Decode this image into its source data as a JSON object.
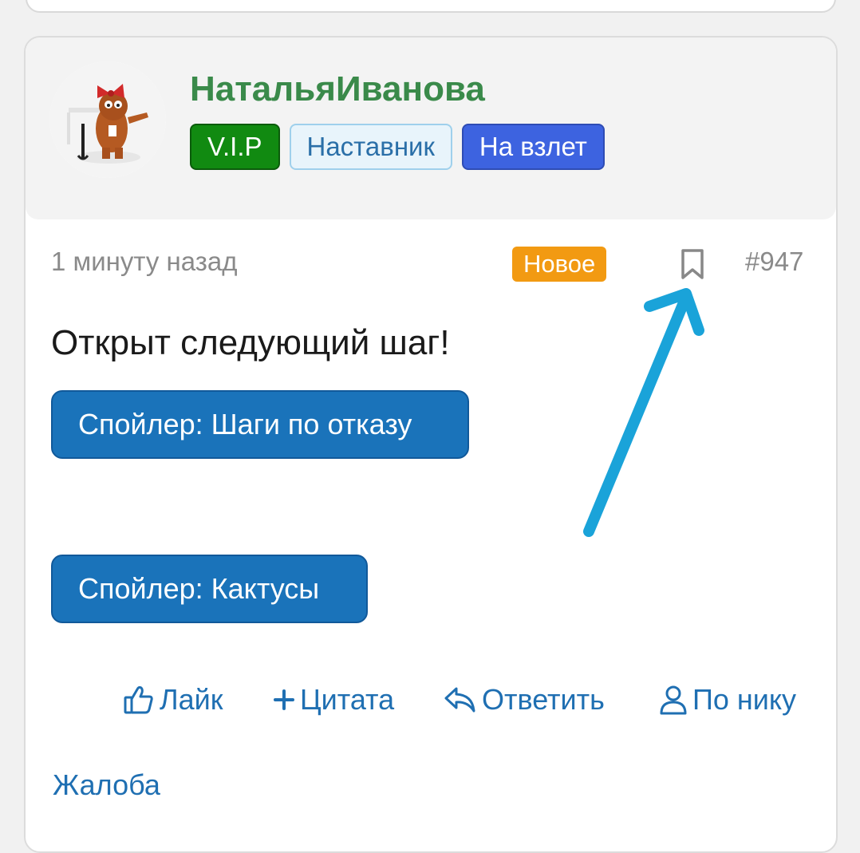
{
  "author": {
    "name": "НатальяИванова",
    "badges": [
      "V.I.P",
      "Наставник",
      "На взлет"
    ]
  },
  "post": {
    "time": "1 минуту назад",
    "new_label": "Новое",
    "number": "#947",
    "text": "Открыт следующий шаг!",
    "spoilers": [
      "Спойлер: Шаги по отказу",
      "Спойлер: Кактусы"
    ]
  },
  "actions": {
    "like": "Лайк",
    "quote": "Цитата",
    "reply": "Ответить",
    "by_nick": "По нику",
    "complaint": "Жалоба"
  },
  "icons": {
    "bookmark": "bookmark-icon",
    "like": "thumbs-up-icon",
    "quote": "plus-icon",
    "reply": "reply-arrow-icon",
    "nick": "user-icon"
  },
  "colors": {
    "author_name": "#3a8a4a",
    "link": "#1f6fb2",
    "spoiler": "#1a73ba",
    "new_badge": "#f29a12",
    "annotation_arrow": "#1aa3d9"
  }
}
